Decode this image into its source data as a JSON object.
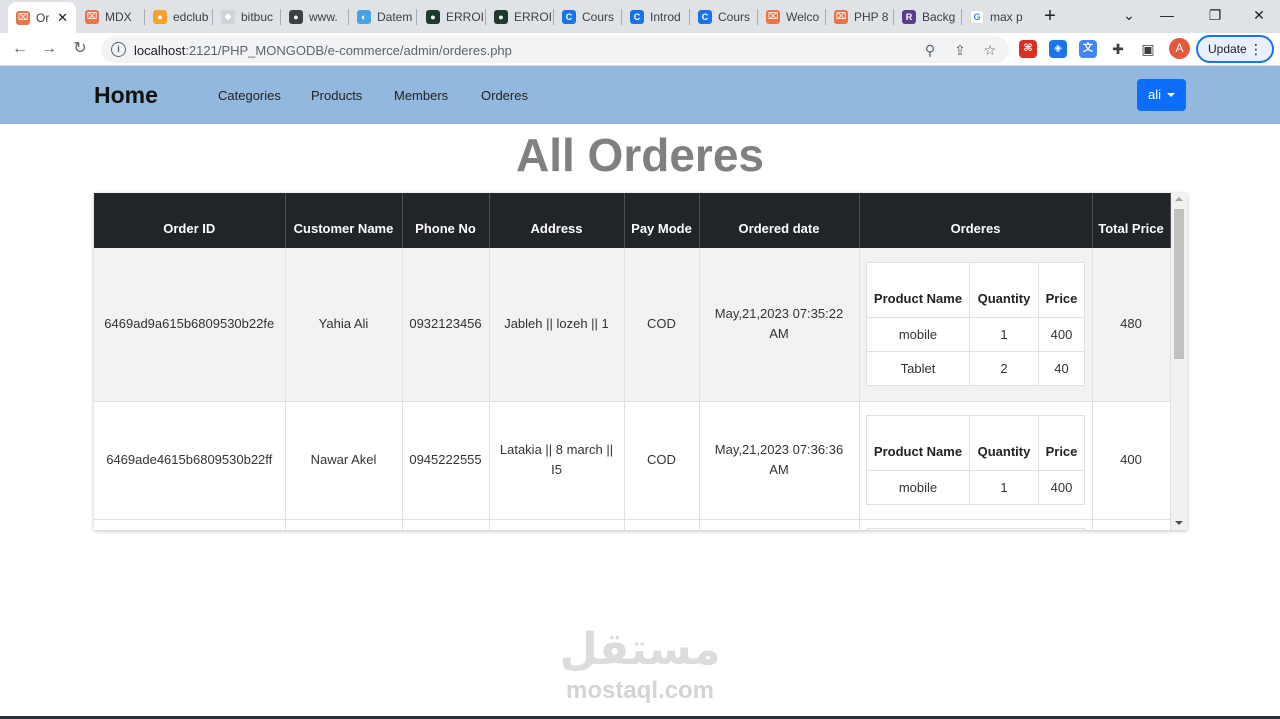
{
  "browser": {
    "tabs": [
      {
        "title": "Or",
        "fav_color": "#e8744c",
        "fav_glyph": "⌧",
        "active": true
      },
      {
        "title": "MDX",
        "fav_color": "#e8744c",
        "fav_glyph": "⌧"
      },
      {
        "title": "edclub",
        "fav_color": "#f6a12b",
        "fav_glyph": "●"
      },
      {
        "title": "bitbuc",
        "fav_color": "#cfd4da",
        "fav_glyph": "◆"
      },
      {
        "title": "www.",
        "fav_color": "#3c4043",
        "fav_glyph": "●"
      },
      {
        "title": "Datem",
        "fav_color": "#4aa3df",
        "fav_glyph": "◐"
      },
      {
        "title": "ERROI",
        "fav_color": "#1e3a2f",
        "fav_glyph": "●"
      },
      {
        "title": "ERROI",
        "fav_color": "#1e3a2f",
        "fav_glyph": "●"
      },
      {
        "title": "Cours",
        "fav_color": "#1a73e8",
        "fav_glyph": "C"
      },
      {
        "title": "Introd",
        "fav_color": "#1a73e8",
        "fav_glyph": "C"
      },
      {
        "title": "Cours",
        "fav_color": "#1a73e8",
        "fav_glyph": "C"
      },
      {
        "title": "Welco",
        "fav_color": "#e8744c",
        "fav_glyph": "⌧"
      },
      {
        "title": "PHP 8",
        "fav_color": "#e8744c",
        "fav_glyph": "⌧"
      },
      {
        "title": "Backg",
        "fav_color": "#5b3b8c",
        "fav_glyph": "R"
      },
      {
        "title": "max p",
        "fav_color": "#ffffff",
        "fav_glyph": "G"
      }
    ],
    "url_host": "localhost",
    "url_rest": ":2121/PHP_MONGODB/e-commerce/admin/orderes.php",
    "profile_initial": "A",
    "update_label": "Update"
  },
  "nav": {
    "brand": "Home",
    "links": [
      "Categories",
      "Products",
      "Members",
      "Orderes"
    ],
    "user": "ali"
  },
  "page": {
    "title": "All Orderes"
  },
  "table": {
    "headers": [
      "Order ID",
      "Customer Name",
      "Phone No",
      "Address",
      "Pay Mode",
      "Ordered date",
      "Orderes",
      "Total Price"
    ],
    "inner_headers": [
      "Product Name",
      "Quantity",
      "Price"
    ],
    "rows": [
      {
        "order_id": "6469ad9a615b6809530b22fe",
        "customer": "Yahia Ali",
        "phone": "0932123456",
        "address": "Jableh || lozeh || 1",
        "pay_mode": "COD",
        "date": "May,21,2023 07:35:22 AM",
        "items": [
          {
            "name": "mobile",
            "qty": "1",
            "price": "400"
          },
          {
            "name": "Tablet",
            "qty": "2",
            "price": "40"
          }
        ],
        "total": "480"
      },
      {
        "order_id": "6469ade4615b6809530b22ff",
        "customer": "Nawar Akel",
        "phone": "0945222555",
        "address": "Latakia || 8 march || I5",
        "pay_mode": "COD",
        "date": "May,21,2023 07:36:36 AM",
        "items": [
          {
            "name": "mobile",
            "qty": "1",
            "price": "400"
          }
        ],
        "total": "400"
      }
    ]
  },
  "watermark": {
    "logo": "مستقل",
    "text": "mostaql.com"
  }
}
